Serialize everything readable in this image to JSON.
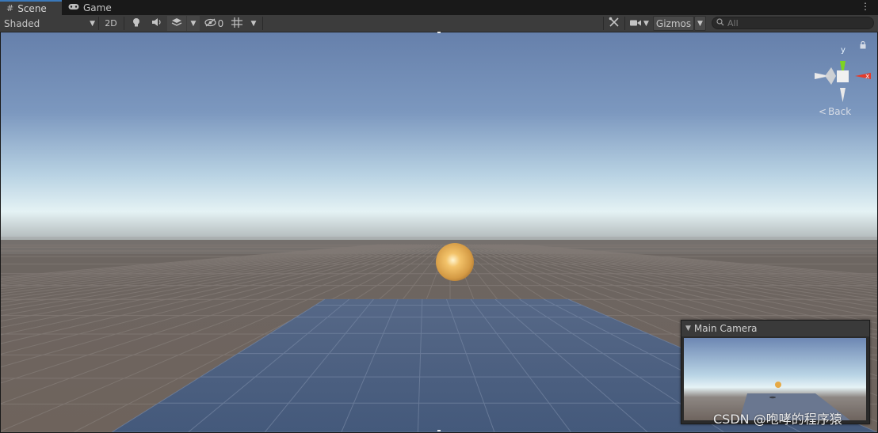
{
  "tabs": [
    {
      "label": "Scene",
      "icon": "grid-icon",
      "active": true
    },
    {
      "label": "Game",
      "icon": "gamepad-icon",
      "active": false
    }
  ],
  "toolbar": {
    "draw_mode": "Shaded",
    "mode_2d": "2D",
    "hidden_count": "0",
    "gizmos_label": "Gizmos"
  },
  "search": {
    "placeholder": "All"
  },
  "orientation_gizmo": {
    "y_label": "y",
    "x_label": "x",
    "back_label": "Back"
  },
  "camera_preview": {
    "title": "Main Camera"
  },
  "watermark": "CSDN @咆哮的程序猿",
  "colors": {
    "sky_top": "#6a83ad",
    "horizon": "#d9ecef",
    "ground": "#6e645e",
    "plane": "#4a5f80",
    "sphere": "#e0a848",
    "axis_y": "#7ed321",
    "axis_x": "#e53b2a",
    "tab_accent": "#3a79bb"
  }
}
